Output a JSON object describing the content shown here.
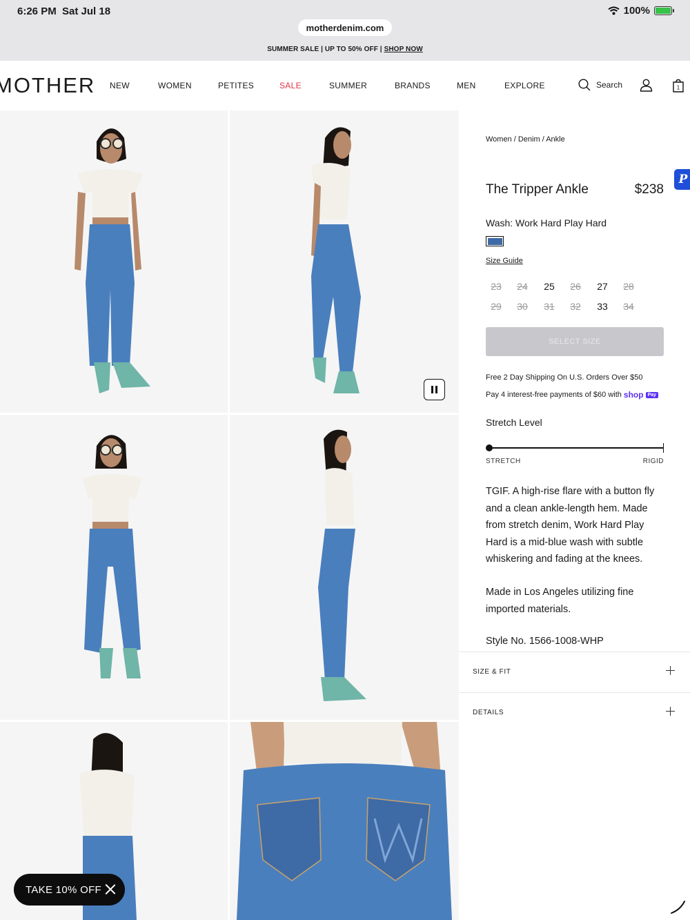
{
  "status_bar": {
    "time": "6:26 PM",
    "date": "Sat Jul 18",
    "battery": "100%"
  },
  "browser": {
    "url": "motherdenim.com"
  },
  "promo": {
    "text": "SUMMER SALE | UP TO 50% OFF | ",
    "link": "SHOP NOW"
  },
  "nav": {
    "logo": "MOTHER",
    "items": [
      "NEW",
      "WOMEN",
      "PETITES",
      "SALE",
      "SUMMER",
      "BRANDS",
      "MEN",
      "EXPLORE"
    ],
    "search_label": "Search",
    "bag_count": "1"
  },
  "product": {
    "breadcrumb": "Women / Denim / Ankle",
    "title": "The Tripper Ankle",
    "price": "$238",
    "wash": "Wash: Work Hard Play Hard",
    "size_guide": "Size Guide",
    "sizes": [
      {
        "label": "23",
        "available": false
      },
      {
        "label": "24",
        "available": false
      },
      {
        "label": "25",
        "available": true
      },
      {
        "label": "26",
        "available": false
      },
      {
        "label": "27",
        "available": true
      },
      {
        "label": "28",
        "available": false
      },
      {
        "label": "29",
        "available": false
      },
      {
        "label": "30",
        "available": false
      },
      {
        "label": "31",
        "available": false
      },
      {
        "label": "32",
        "available": false
      },
      {
        "label": "33",
        "available": true
      },
      {
        "label": "34",
        "available": false
      }
    ],
    "select_button": "SELECT SIZE",
    "shipping": "Free 2 Day Shipping On U.S. Orders Over $50",
    "installments": "Pay 4 interest-free payments of $60 with",
    "shop_pay": {
      "brand": "shop",
      "badge": "Pay"
    },
    "stretch": {
      "title": "Stretch Level",
      "min_label": "STRETCH",
      "max_label": "RIGID",
      "level": 0
    },
    "description": "TGIF. A high-rise flare with a button fly and a clean ankle-length hem. Made from stretch denim, Work Hard Play Hard is a mid-blue wash with subtle whiskering and fading at the knees.",
    "made_in": "Made in Los Angeles utilizing fine imported materials.",
    "style_no": "Style No. 1566-1008-WHP",
    "accordions": [
      "SIZE & FIT",
      "DETAILS"
    ]
  },
  "paypal_tab": "P",
  "offer": {
    "label": "TAKE 10% OFF"
  },
  "colors": {
    "sale": "#e0334a",
    "denim": "#3e6aa6",
    "boots": "#6fb5a8",
    "shop_pay": "#5a31f4",
    "paypal": "#1f4fd8"
  }
}
